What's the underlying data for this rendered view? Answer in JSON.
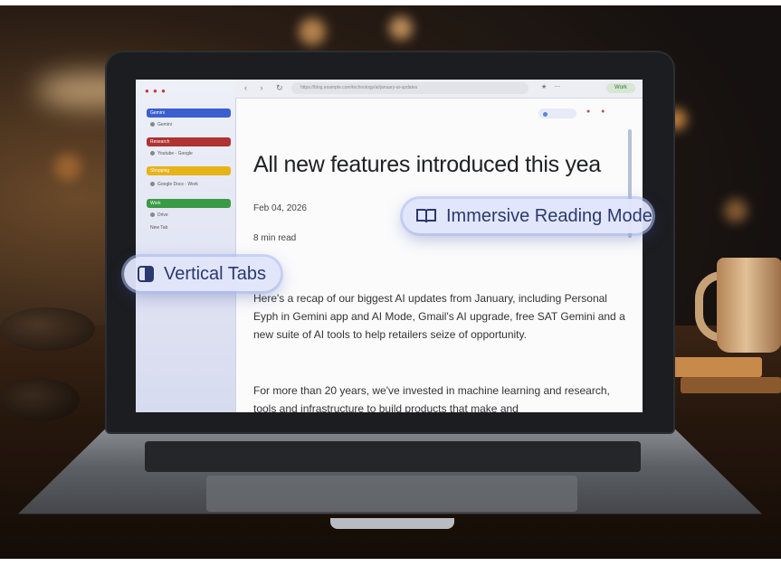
{
  "article": {
    "title": "All new features introduced this yea",
    "date": "Feb 04, 2026",
    "read_time": "8 min read",
    "paragraph1": "Here's a recap of our biggest AI updates from January, including Personal Eyph in Gemini app and AI Mode, Gmail's AI upgrade, free SAT Gemini and a new suite of AI tools to help retailers seize of opportunity.",
    "paragraph2": "For more than 20 years, we've invested in machine learning and research, tools and infrastructure to build products that make and"
  },
  "callouts": {
    "vertical_tabs": "Vertical Tabs",
    "immersive_reading": "Immersive Reading Mode"
  },
  "browser": {
    "url": "https://blog.example.com/technology/ai/january-ai-updates",
    "profile": "Work"
  },
  "sidebar": {
    "groups": [
      {
        "label": "Gemini",
        "color": "#3b5fcf"
      },
      {
        "label": "Research",
        "color": "#b03232"
      },
      {
        "label": "Shopping",
        "color": "#e6b319"
      },
      {
        "label": "Work",
        "color": "#3a9a46"
      }
    ],
    "items": [
      "Gemini",
      "Youtube - Google",
      "Google Docs - Work",
      "Drive",
      "New Tab"
    ]
  },
  "colors": {
    "callout_bg": "#e0e5fa",
    "callout_text": "#2a3a6e"
  }
}
